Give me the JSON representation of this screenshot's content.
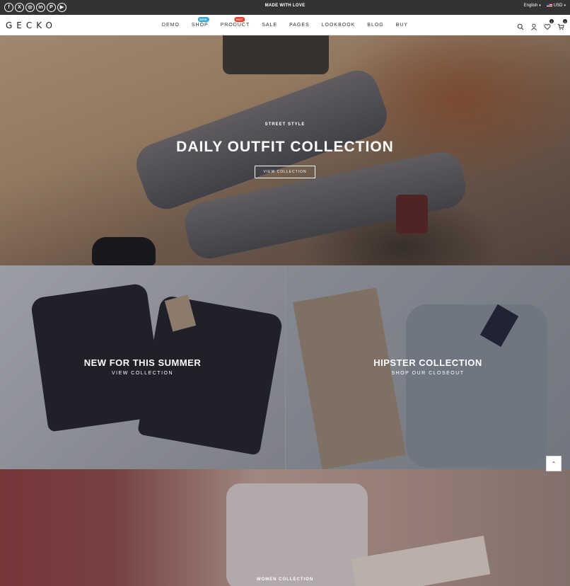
{
  "topbar": {
    "socials": [
      {
        "icon": "facebook-icon",
        "glyph": "f"
      },
      {
        "icon": "x-icon",
        "glyph": "X"
      },
      {
        "icon": "instagram-icon",
        "glyph": "◎"
      },
      {
        "icon": "linkedin-icon",
        "glyph": "in"
      },
      {
        "icon": "pinterest-icon",
        "glyph": "P"
      },
      {
        "icon": "youtube-icon",
        "glyph": "▶"
      }
    ],
    "message": "MADE WITH LOVE",
    "language": "English",
    "currency": "USD"
  },
  "header": {
    "logo": "GECKO",
    "nav": [
      {
        "label": "DEMO",
        "badge": ""
      },
      {
        "label": "SHOP",
        "badge": "NEW"
      },
      {
        "label": "PRODUCT",
        "badge": "HOT"
      },
      {
        "label": "SALE",
        "badge": ""
      },
      {
        "label": "PAGES",
        "badge": ""
      },
      {
        "label": "LOOKBOOK",
        "badge": ""
      },
      {
        "label": "BLOG",
        "badge": ""
      },
      {
        "label": "BUY",
        "badge": ""
      }
    ],
    "wishlist_count": "0",
    "cart_count": "0"
  },
  "hero": {
    "eyebrow": "STREET STYLE",
    "title": "DAILY OUTFIT COLLECTION",
    "button": "VIEW COLLECTION"
  },
  "banners": [
    {
      "title": "NEW FOR THIS SUMMER",
      "subtitle": "VIEW COLLECTION"
    },
    {
      "title": "HIPSTER COLLECTION",
      "subtitle": "SHOP OUR CLOSEOUT"
    }
  ],
  "bottom": {
    "label": "WOMEN COLLECTION"
  },
  "colors": {
    "topbar_bg": "#333333",
    "badge_new": "#35a9d6",
    "badge_hot": "#e8402e"
  }
}
